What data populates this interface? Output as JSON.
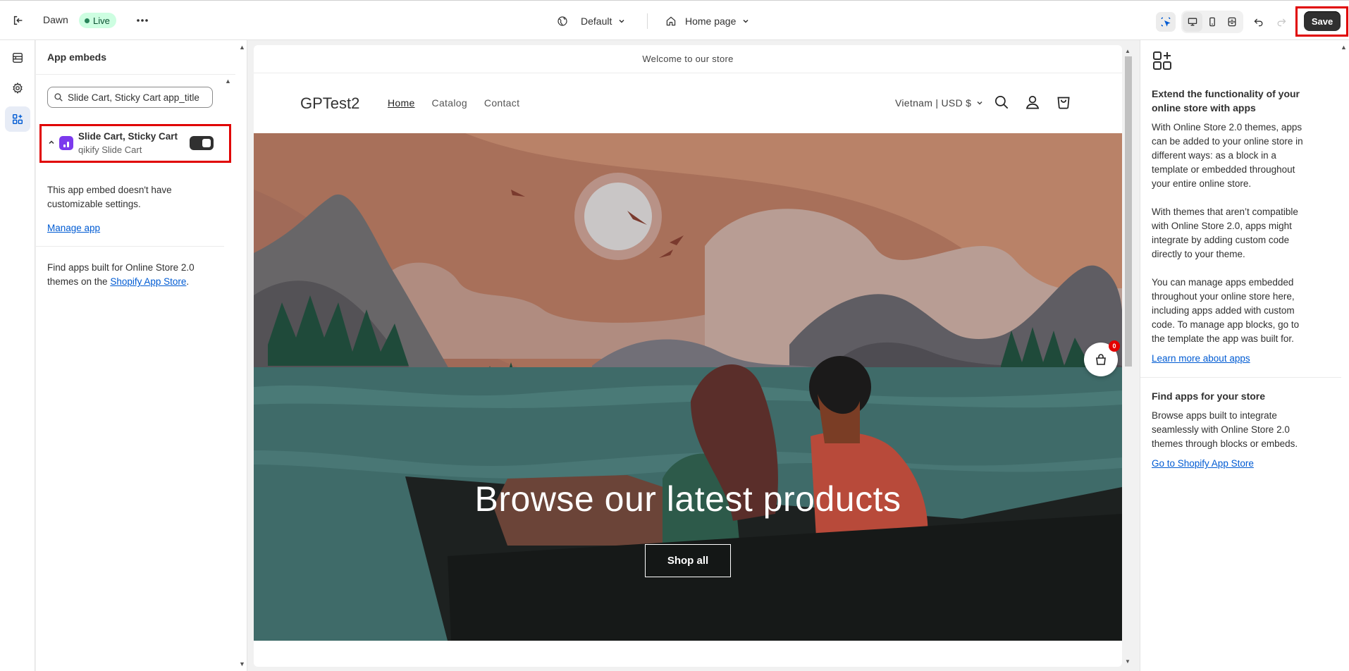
{
  "topbar": {
    "theme_name": "Dawn",
    "status_badge": "Live",
    "template_select": "Default",
    "page_select": "Home page",
    "save_label": "Save"
  },
  "left_panel": {
    "title": "App embeds",
    "search_value": "Slide Cart, Sticky Cart app_title",
    "embed": {
      "name": "Slide Cart, Sticky Cart",
      "provider": "qikify Slide Cart",
      "enabled": true
    },
    "note": "This app embed doesn't have customizable settings.",
    "manage_link": "Manage app",
    "find_text": "Find apps built for Online Store 2.0 themes on the ",
    "find_link": "Shopify App Store",
    "find_end": "."
  },
  "preview": {
    "announcement": "Welcome to our store",
    "store_name": "GPTest2",
    "nav": [
      "Home",
      "Catalog",
      "Contact"
    ],
    "locale": "Vietnam | USD $",
    "hero_title": "Browse our latest products",
    "hero_button": "Shop all",
    "cart_count": "0"
  },
  "right_panel": {
    "heading1": "Extend the functionality of your online store with apps",
    "p1": "With Online Store 2.0 themes, apps can be added to your online store in different ways: as a block in a template or embedded throughout your entire online store.",
    "p2": "With themes that aren’t compatible with Online Store 2.0, apps might integrate by adding custom code directly to your theme.",
    "p3": "You can manage apps embedded throughout your online store here, including apps added with custom code. To manage app blocks, go to the template the app was built for.",
    "link1": "Learn more about apps",
    "heading2": "Find apps for your store",
    "p4": "Browse apps built to integrate seamlessly with Online Store 2.0 themes through blocks or embeds.",
    "link2": "Go to Shopify App Store"
  },
  "colors": {
    "highlight": "#e00000",
    "link": "#005bd3",
    "live_badge": "#cdfee1",
    "app_icon": "#7c3aed"
  }
}
